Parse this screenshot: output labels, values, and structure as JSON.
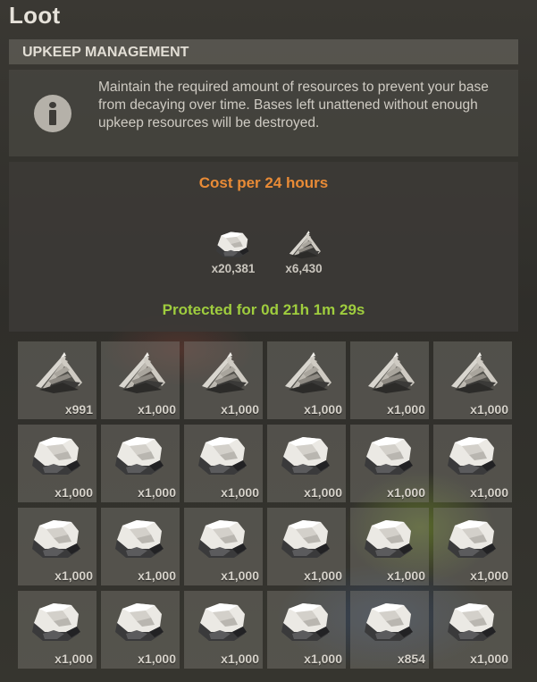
{
  "window": {
    "title": "Loot"
  },
  "upkeep": {
    "header": "UPKEEP MANAGEMENT",
    "info_icon": "info-icon",
    "info_text": "Maintain the required amount of resources to prevent your base from decaying over time. Bases left unattened without enough upkeep resources will be destroyed."
  },
  "cost": {
    "title": "Cost per 24 hours",
    "items": [
      {
        "icon": "stones-icon",
        "qty": "x20,381"
      },
      {
        "icon": "wood-icon",
        "qty": "x6,430"
      }
    ],
    "protected": "Protected for 0d 21h 1m 29s"
  },
  "colors": {
    "cost_title": "#e98b36",
    "protected": "#9fcd3e"
  },
  "inventory": {
    "slots": [
      {
        "icon": "wood-icon",
        "qty": "x991"
      },
      {
        "icon": "wood-icon",
        "qty": "x1,000"
      },
      {
        "icon": "wood-icon",
        "qty": "x1,000"
      },
      {
        "icon": "wood-icon",
        "qty": "x1,000"
      },
      {
        "icon": "wood-icon",
        "qty": "x1,000"
      },
      {
        "icon": "wood-icon",
        "qty": "x1,000"
      },
      {
        "icon": "stones-icon",
        "qty": "x1,000"
      },
      {
        "icon": "stones-icon",
        "qty": "x1,000"
      },
      {
        "icon": "stones-icon",
        "qty": "x1,000"
      },
      {
        "icon": "stones-icon",
        "qty": "x1,000"
      },
      {
        "icon": "stones-icon",
        "qty": "x1,000"
      },
      {
        "icon": "stones-icon",
        "qty": "x1,000"
      },
      {
        "icon": "stones-icon",
        "qty": "x1,000"
      },
      {
        "icon": "stones-icon",
        "qty": "x1,000"
      },
      {
        "icon": "stones-icon",
        "qty": "x1,000"
      },
      {
        "icon": "stones-icon",
        "qty": "x1,000"
      },
      {
        "icon": "stones-icon",
        "qty": "x1,000"
      },
      {
        "icon": "stones-icon",
        "qty": "x1,000"
      },
      {
        "icon": "stones-icon",
        "qty": "x1,000"
      },
      {
        "icon": "stones-icon",
        "qty": "x1,000"
      },
      {
        "icon": "stones-icon",
        "qty": "x1,000"
      },
      {
        "icon": "stones-icon",
        "qty": "x1,000"
      },
      {
        "icon": "stones-icon",
        "qty": "x854"
      },
      {
        "icon": "stones-icon",
        "qty": "x1,000"
      }
    ]
  }
}
